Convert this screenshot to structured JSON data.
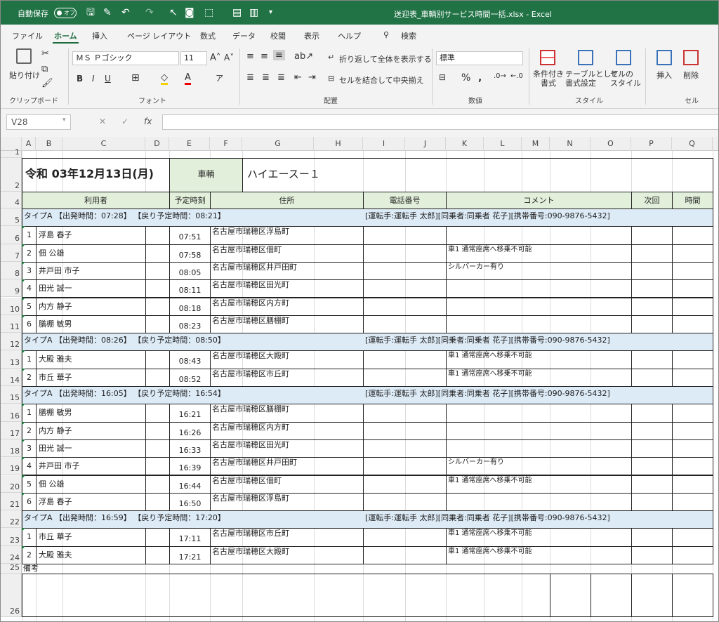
{
  "titlebar": {
    "autosave": "自動保存",
    "toggle": "オフ",
    "title": "送迎表_車輌別サービス時間一括.xlsx - Excel"
  },
  "menu": [
    "ファイル",
    "ホーム",
    "挿入",
    "ページ レイアウト",
    "数式",
    "データ",
    "校閲",
    "表示",
    "ヘルプ",
    "検索"
  ],
  "ribbon": {
    "paste": "貼り付け",
    "clipboard": "クリップボード",
    "font_name": "ＭＳ Ｐゴシック",
    "font_size": "11",
    "font_group": "フォント",
    "wrap": "折り返して全体を表示する",
    "merge": "セルを結合して中央揃え",
    "align_group": "配置",
    "number_format": "標準",
    "number_group": "数値",
    "cond": "条件付き\n書式",
    "table": "テーブルとして\n書式設定",
    "cellstyle": "セルの\nスタイル",
    "style_group": "スタイル",
    "insert": "挿入",
    "delete": "削除",
    "cell_group": "セル"
  },
  "namebox": "V28",
  "columns": [
    "A",
    "B",
    "C",
    "D",
    "E",
    "F",
    "G",
    "H",
    "I",
    "J",
    "K",
    "L",
    "M",
    "N",
    "O",
    "P",
    "Q"
  ],
  "sheet": {
    "date": "令和 03年12月13日(月)",
    "vehicle_label": "車輌",
    "vehicle": "ハイエースー１",
    "headers": [
      "利用者",
      "予定時刻",
      "住所",
      "電話番号",
      "コメント",
      "次回",
      "時間"
    ],
    "remarks": "備考",
    "sections": [
      {
        "title": "タイプA 【出発時間：07:28】 【戻り予定時間：08:21】",
        "info": "[運転手:運転手 太郎][同乗者:同乗者 花子][携帯番号:090-9876-5432]",
        "rows": [
          [
            "1",
            "浮島 春子",
            "07:51",
            "名古屋市瑞穂区浮島町",
            ""
          ],
          [
            "2",
            "佃 公雄",
            "07:58",
            "名古屋市瑞穂区佃町",
            "車1 通常座席へ移乗不可能"
          ],
          [
            "3",
            "井戸田 市子",
            "08:05",
            "名古屋市瑞穂区井戸田町",
            "シルバーカー有り"
          ],
          [
            "4",
            "田光 誠一",
            "08:11",
            "名古屋市瑞穂区田光町",
            ""
          ],
          [
            "5",
            "内方 静子",
            "08:18",
            "名古屋市瑞穂区内方町",
            ""
          ],
          [
            "6",
            "膳棚 敏男",
            "08:23",
            "名古屋市瑞穂区膳棚町",
            ""
          ]
        ]
      },
      {
        "title": "タイプA 【出発時間：08:26】 【戻り予定時間：08:50】",
        "info": "[運転手:運転手 太郎][同乗者:同乗者 花子][携帯番号:090-9876-5432]",
        "rows": [
          [
            "1",
            "大殿 雅夫",
            "08:43",
            "名古屋市瑞穂区大殿町",
            "車1 通常座席へ移乗不可能"
          ],
          [
            "2",
            "市丘 華子",
            "08:52",
            "名古屋市瑞穂区市丘町",
            "車1 通常座席へ移乗不可能"
          ]
        ]
      },
      {
        "title": "タイプA 【出発時間：16:05】 【戻り予定時間：16:54】",
        "info": "[運転手:運転手 太郎][同乗者:同乗者 花子][携帯番号:090-9876-5432]",
        "rows": [
          [
            "1",
            "膳棚 敏男",
            "16:21",
            "名古屋市瑞穂区膳棚町",
            ""
          ],
          [
            "2",
            "内方 静子",
            "16:26",
            "名古屋市瑞穂区内方町",
            ""
          ],
          [
            "3",
            "田光 誠一",
            "16:33",
            "名古屋市瑞穂区田光町",
            ""
          ],
          [
            "4",
            "井戸田 市子",
            "16:39",
            "名古屋市瑞穂区井戸田町",
            "シルバーカー有り"
          ],
          [
            "5",
            "佃 公雄",
            "16:44",
            "名古屋市瑞穂区佃町",
            "車1 通常座席へ移乗不可能"
          ],
          [
            "6",
            "浮島 春子",
            "16:50",
            "名古屋市瑞穂区浮島町",
            ""
          ]
        ]
      },
      {
        "title": "タイプA 【出発時間：16:59】 【戻り予定時間：17:20】",
        "info": "[運転手:運転手 太郎][同乗者:同乗者 花子][携帯番号:090-9876-5432]",
        "rows": [
          [
            "1",
            "市丘 華子",
            "17:11",
            "名古屋市瑞穂区市丘町",
            "車1 通常座席へ移乗不可能"
          ],
          [
            "2",
            "大殿 雅夫",
            "17:21",
            "名古屋市瑞穂区大殿町",
            "車1 通常座席へ移乗不可能"
          ]
        ]
      }
    ]
  },
  "row_numbers": [
    "1",
    "2",
    "4",
    "5",
    "6",
    "7",
    "8",
    "9",
    "10",
    "11",
    "12",
    "13",
    "14",
    "15",
    "16",
    "17",
    "18",
    "19",
    "20",
    "21",
    "22",
    "23",
    "24",
    "25",
    "26"
  ]
}
